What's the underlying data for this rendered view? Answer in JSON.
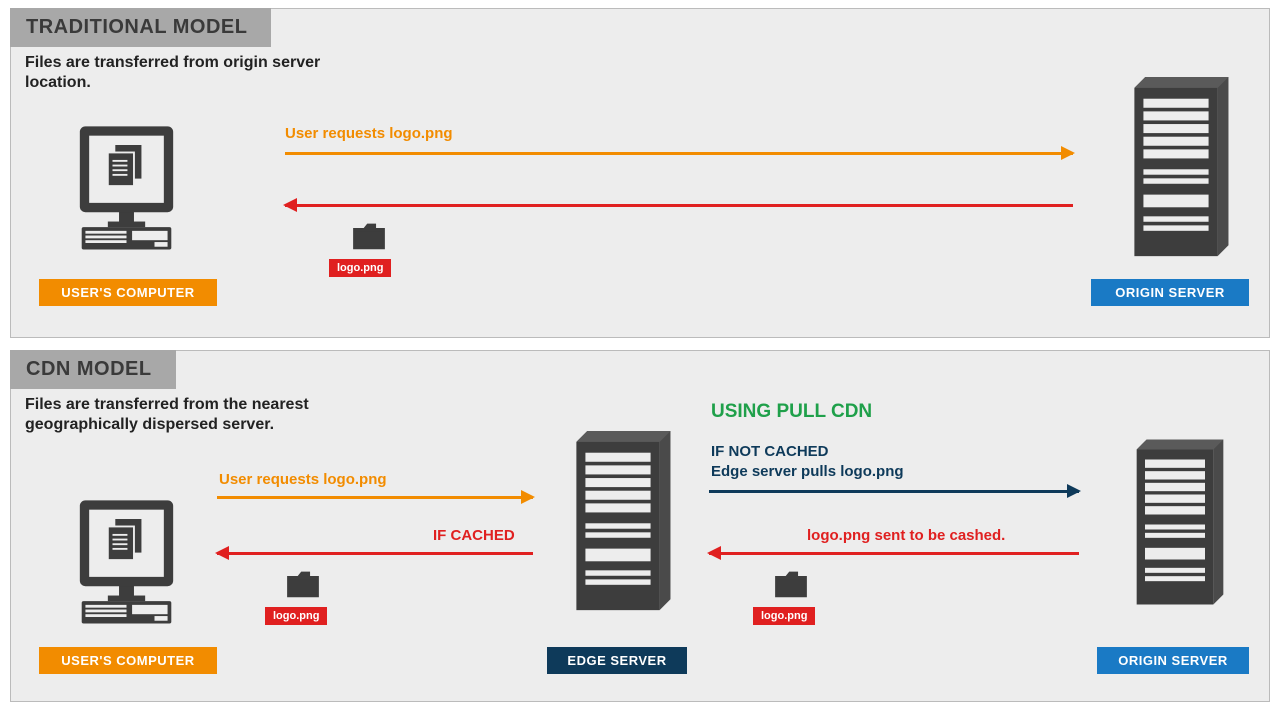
{
  "traditional": {
    "title": "TRADITIONAL MODEL",
    "subtitle": "Files are transferred from origin server location.",
    "user_label": "USER'S COMPUTER",
    "origin_label": "ORIGIN SERVER",
    "request_label": "User requests logo.png",
    "file_tag": "logo.png"
  },
  "cdn": {
    "title": "CDN MODEL",
    "subtitle": "Files are transferred from the nearest geographically dispersed server.",
    "pull_title": "USING PULL CDN",
    "user_label": "USER'S COMPUTER",
    "edge_label": "EDGE SERVER",
    "origin_label": "ORIGIN SERVER",
    "request_label": "User requests logo.png",
    "cached_label": "IF CACHED",
    "not_cached_label": "IF NOT CACHED",
    "edge_pull_label": "Edge server pulls logo.png",
    "response2_label": "logo.png sent to be cashed.",
    "file_tag": "logo.png"
  },
  "colors": {
    "orange": "#f28c00",
    "red": "#e02020",
    "blue": "#1a7ac5",
    "navy": "#0e3a5a",
    "green": "#1fa04a"
  }
}
